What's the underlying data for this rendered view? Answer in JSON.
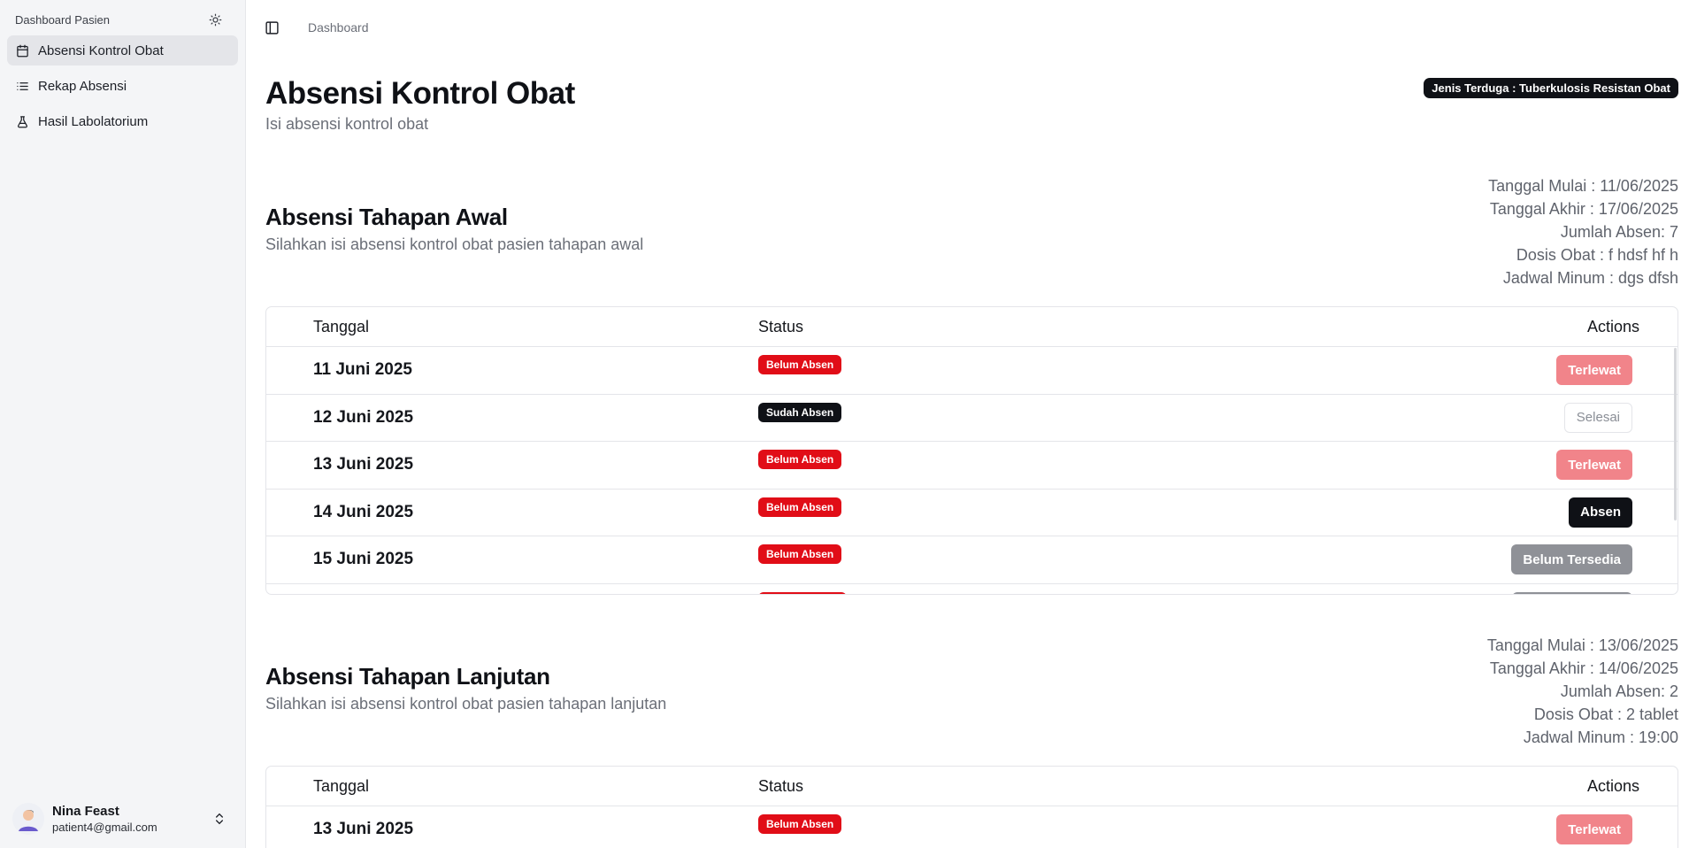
{
  "sidebar": {
    "app_name": "Dashboard Pasien",
    "theme_icon": "sun-icon",
    "items": [
      {
        "label": "Absensi Kontrol Obat",
        "icon": "calendar-icon",
        "active": true
      },
      {
        "label": "Rekap Absensi",
        "icon": "list-icon",
        "active": false
      },
      {
        "label": "Hasil Labolatorium",
        "icon": "flask-icon",
        "active": false
      }
    ],
    "user": {
      "name": "Nina Feast",
      "email": "patient4@gmail.com"
    }
  },
  "topbar": {
    "breadcrumb": "Dashboard"
  },
  "page": {
    "title": "Absensi Kontrol Obat",
    "subtitle": "Isi absensi kontrol obat",
    "type_badge": "Jenis Terduga : Tuberkulosis Resistan Obat"
  },
  "table_headers": {
    "date": "Tanggal",
    "status": "Status",
    "actions": "Actions"
  },
  "sections": [
    {
      "title": "Absensi Tahapan Awal",
      "subtitle": "Silahkan isi absensi kontrol obat pasien tahapan awal",
      "meta": [
        "Tanggal Mulai : 11/06/2025",
        "Tanggal Akhir : 17/06/2025",
        "Jumlah Absen: 7",
        "Dosis Obat : f hdsf hf h",
        "Jadwal Minum : dgs dfsh"
      ],
      "rows": [
        {
          "date": "11 Juni 2025",
          "status": "Belum Absen",
          "action": "Terlewat"
        },
        {
          "date": "12 Juni 2025",
          "status": "Sudah Absen",
          "action": "Selesai"
        },
        {
          "date": "13 Juni 2025",
          "status": "Belum Absen",
          "action": "Terlewat"
        },
        {
          "date": "14 Juni 2025",
          "status": "Belum Absen",
          "action": "Absen"
        },
        {
          "date": "15 Juni 2025",
          "status": "Belum Absen",
          "action": "Belum Tersedia"
        }
      ]
    },
    {
      "title": "Absensi Tahapan Lanjutan",
      "subtitle": "Silahkan isi absensi kontrol obat pasien tahapan lanjutan",
      "meta": [
        "Tanggal Mulai : 13/06/2025",
        "Tanggal Akhir : 14/06/2025",
        "Jumlah Absen: 2",
        "Dosis Obat : 2 tablet",
        "Jadwal Minum : 19:00"
      ],
      "rows": [
        {
          "date": "13 Juni 2025",
          "status": "Belum Absen",
          "action": "Terlewat"
        }
      ]
    }
  ],
  "colors": {
    "danger": "#e10d17",
    "primary": "#0f1116",
    "missed": "#f1848a",
    "unavailable": "#8f9197"
  }
}
